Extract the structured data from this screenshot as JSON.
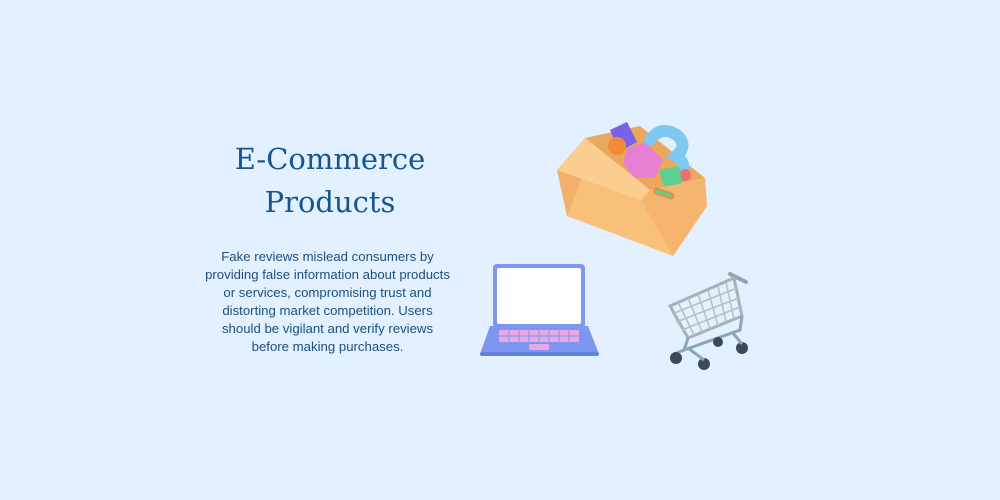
{
  "hero": {
    "title_line1": "E-Commerce",
    "title_line2": "Products",
    "description": "Fake reviews mislead consumers by providing false information about products or services, compromising trust and distorting market competition. Users should be vigilant and verify reviews before making purchases."
  },
  "illustrations": {
    "box": "box-of-goods-icon",
    "laptop": "laptop-icon",
    "cart": "shopping-cart-icon"
  },
  "colors": {
    "background": "#e2f0ff",
    "title": "#17558f",
    "text": "#1c4f7e",
    "box": "#f8c27f",
    "laptop": "#7d97f0",
    "cart": "#a9b0b6"
  }
}
